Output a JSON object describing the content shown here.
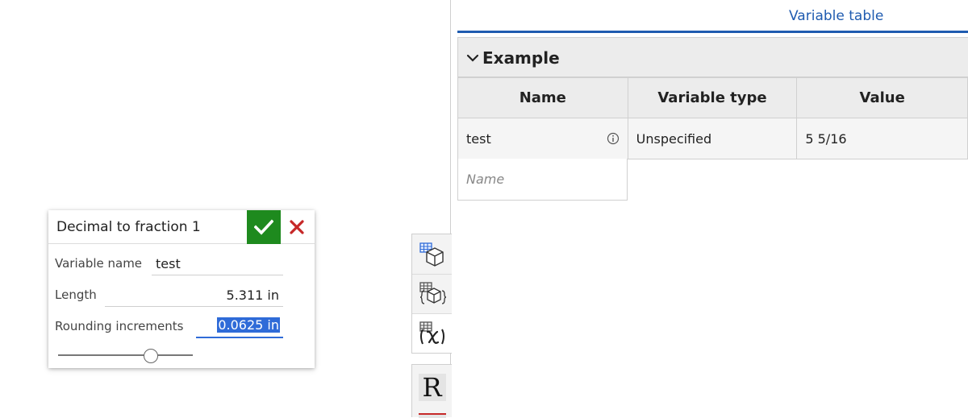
{
  "dialog": {
    "title": "Decimal to fraction 1",
    "fields": {
      "variable_name": {
        "label": "Variable name",
        "value": "test"
      },
      "length": {
        "label": "Length",
        "value": "5.311 in"
      },
      "rounding": {
        "label": "Rounding increments",
        "value": "0.0625 in"
      }
    },
    "slider_value": 0.7
  },
  "side_tabs": [
    {
      "icon": "table-cube-icon"
    },
    {
      "icon": "table-cube-braces-icon"
    },
    {
      "icon": "variable-table-icon"
    },
    {
      "icon": "r-icon",
      "glyph": "R"
    }
  ],
  "variable_table": {
    "title": "Variable table",
    "section": "Example",
    "columns": [
      "Name",
      "Variable type",
      "Value"
    ],
    "rows": [
      {
        "name": "test",
        "type": "Unspecified",
        "value": "5 5/16"
      }
    ],
    "new_row_placeholder": "Name"
  },
  "colors": {
    "accent_blue": "#1f5bb0",
    "confirm_green": "#1e8a1e",
    "cancel_red": "#c62828",
    "selection_blue": "#2f6bd8"
  }
}
